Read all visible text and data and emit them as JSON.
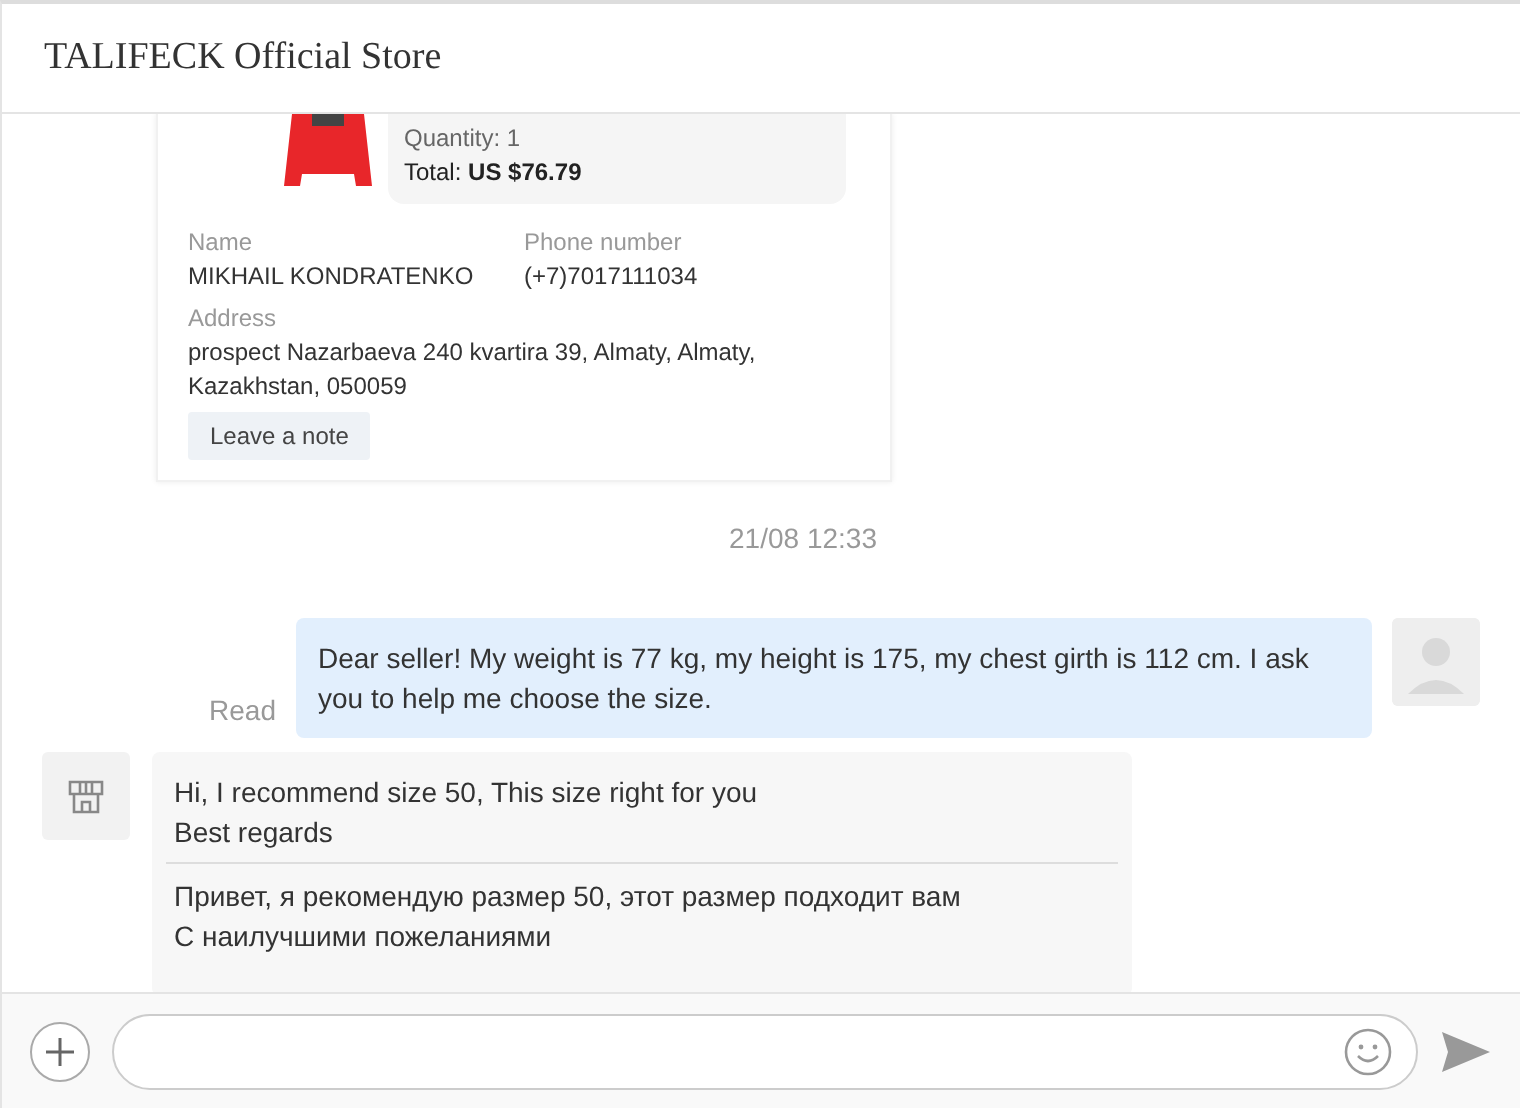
{
  "window": {
    "title": "TALIFECK Official Store"
  },
  "order": {
    "quantity": "Quantity: 1",
    "total_label": "Total:",
    "total": "US $76.79",
    "name_label": "Name",
    "name": "MIKHAIL KONDRATENKO",
    "phone_label": "Phone number",
    "phone": "(+7)7017111034",
    "address_label": "Address",
    "address": "prospect Nazarbaeva 240 kvartira 39, Almaty, Almaty, Kazakhstan, 050059",
    "note_button": "Leave a note"
  },
  "timestamp": "21/08 12:33",
  "messages": [
    {
      "kind": "sent",
      "status": "Read",
      "text": "Dear seller! My weight is 77 kg, my height is 175, my chest girth is 112 cm. I ask you to help me choose the size."
    },
    {
      "kind": "received",
      "text": "Hi, I recommend size 50, This size right for you\nBest regards",
      "translation": "Привет, я рекомендую размер 50, этот размер подходит вам\nС наилучшими пожеланиями"
    }
  ]
}
